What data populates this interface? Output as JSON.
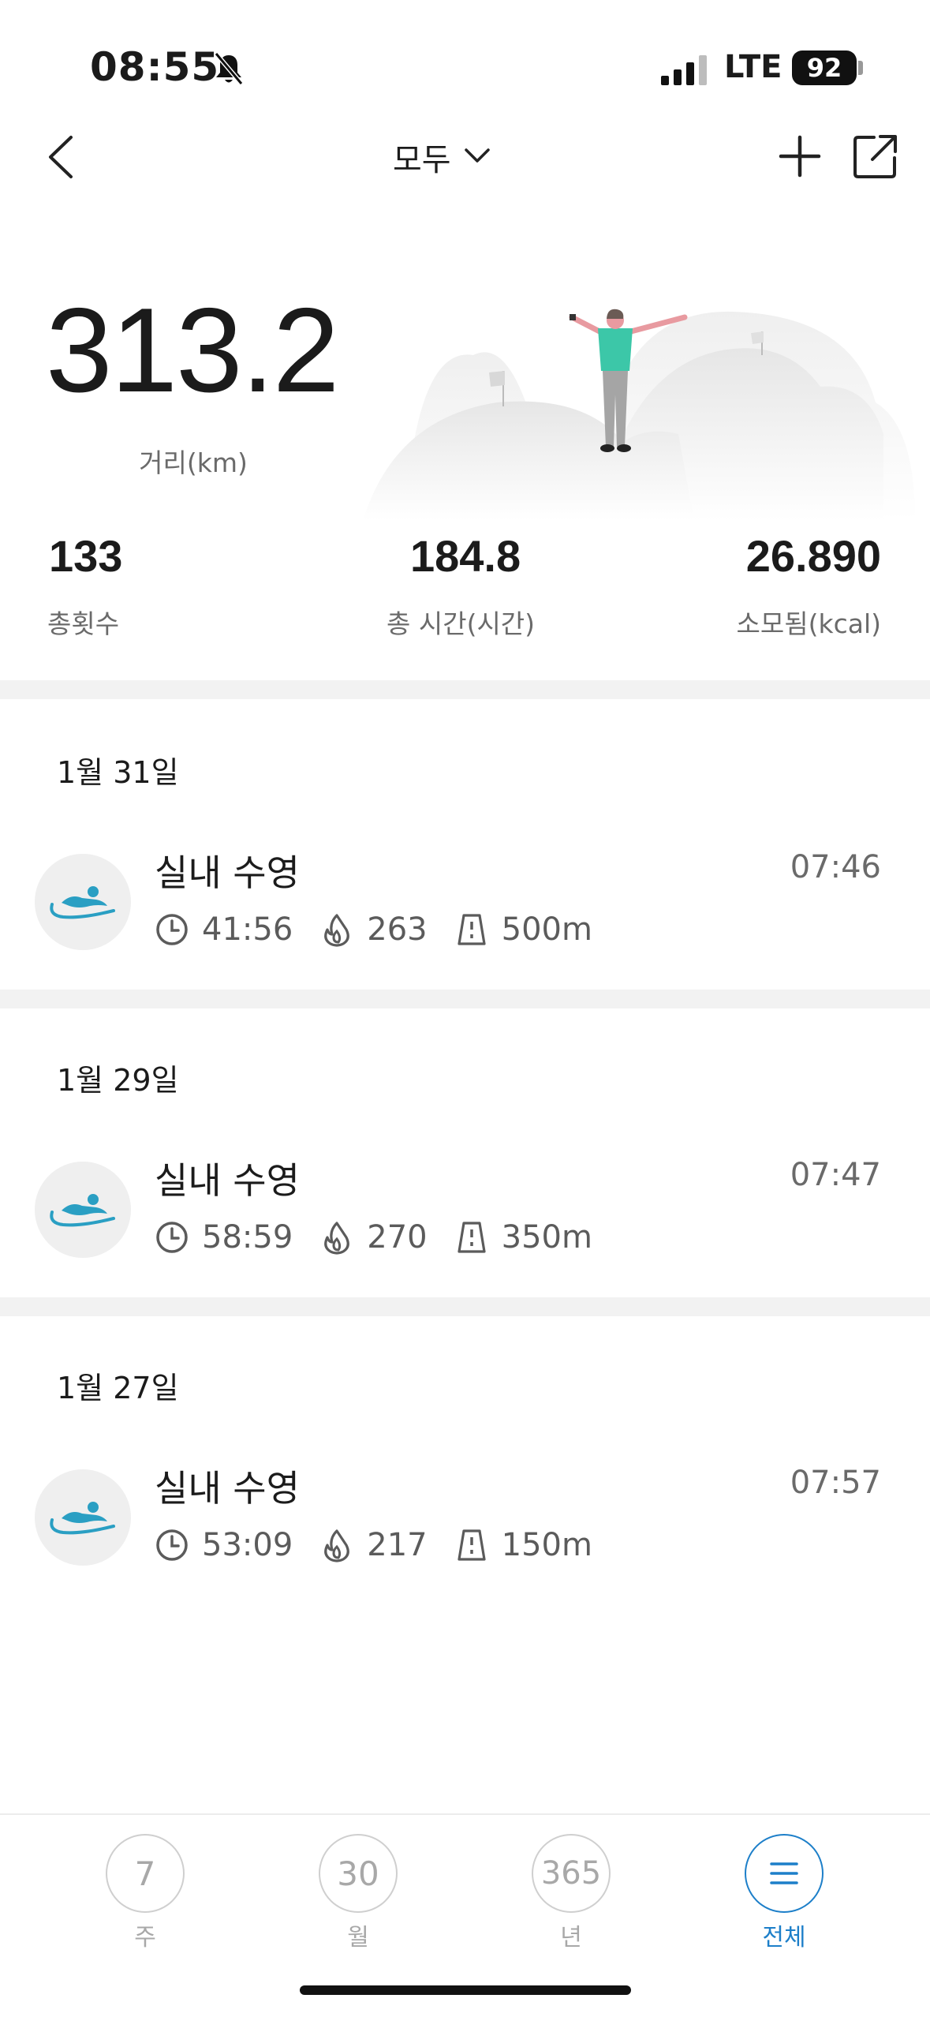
{
  "status": {
    "time": "08:55",
    "network": "LTE",
    "battery": "92"
  },
  "nav": {
    "filter_label": "모두"
  },
  "summary": {
    "distance": "313.2",
    "distance_label": "거리(km)",
    "stats": [
      {
        "value": "133",
        "label": "총횟수"
      },
      {
        "value": "184.8",
        "label": "총 시간(시간)"
      },
      {
        "value": "26.890",
        "label": "소모됨(kcal)"
      }
    ]
  },
  "activities": [
    {
      "date": "1월 31일",
      "title": "실내 수영",
      "time": "07:46",
      "duration": "41:56",
      "calories": "263",
      "distance": "500m"
    },
    {
      "date": "1월 29일",
      "title": "실내 수영",
      "time": "07:47",
      "duration": "58:59",
      "calories": "270",
      "distance": "350m"
    },
    {
      "date": "1월 27일",
      "title": "실내 수영",
      "time": "07:57",
      "duration": "53:09",
      "calories": "217",
      "distance": "150m"
    }
  ],
  "tabs": [
    {
      "icon_text": "7",
      "label": "주",
      "active": false
    },
    {
      "icon_text": "30",
      "label": "월",
      "active": false
    },
    {
      "icon_text": "365",
      "label": "년",
      "active": false
    },
    {
      "icon_text": "",
      "icon": "menu-icon",
      "label": "전체",
      "active": true
    }
  ],
  "colors": {
    "accent": "#1d7fc9",
    "swim": "#2a9fc3",
    "divider": "#f2f2f2"
  }
}
